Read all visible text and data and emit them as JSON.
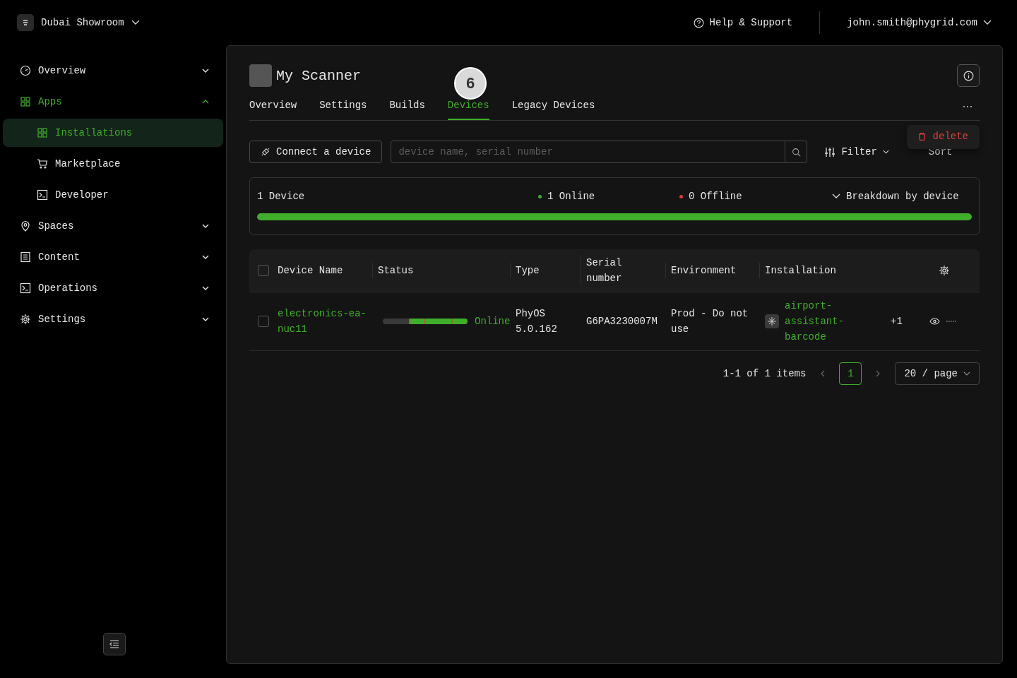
{
  "workspace": {
    "name": "Dubai Showroom"
  },
  "header": {
    "help": "Help & Support",
    "user": "john.smith@phygrid.com"
  },
  "sidebar": {
    "items": [
      {
        "label": "Overview",
        "kind": "gauge",
        "expanded": false,
        "selected": false
      },
      {
        "label": "Apps",
        "kind": "grid",
        "expanded": true,
        "selected": true,
        "children": [
          {
            "label": "Installations",
            "kind": "grid",
            "selected": true
          },
          {
            "label": "Marketplace",
            "kind": "cart",
            "selected": false
          },
          {
            "label": "Developer",
            "kind": "terminal",
            "selected": false
          }
        ]
      },
      {
        "label": "Spaces",
        "kind": "pin",
        "expanded": false,
        "selected": false
      },
      {
        "label": "Content",
        "kind": "list",
        "expanded": false,
        "selected": false
      },
      {
        "label": "Operations",
        "kind": "terminal",
        "expanded": false,
        "selected": false
      },
      {
        "label": "Settings",
        "kind": "gear",
        "expanded": false,
        "selected": false
      }
    ]
  },
  "app": {
    "title": "My Scanner",
    "badge": "6"
  },
  "tabs": [
    {
      "label": "Overview",
      "selected": false
    },
    {
      "label": "Settings",
      "selected": false
    },
    {
      "label": "Builds",
      "selected": false
    },
    {
      "label": "Devices",
      "selected": true
    },
    {
      "label": "Legacy Devices",
      "selected": false
    }
  ],
  "menu": {
    "label": "delete"
  },
  "toolbar": {
    "connect": "Connect a device",
    "search_placeholder": "device name, serial number",
    "filter": "Filter",
    "sort": "Sort"
  },
  "summary": {
    "count": "1 Device",
    "online": "1 Online",
    "offline": "0 Offline",
    "breakdown": "Breakdown by device",
    "level": 1
  },
  "table": {
    "select_all_checked": false,
    "columns": [
      "Device Name",
      "Status",
      "Type",
      "Serial number",
      "Environment",
      "Installation"
    ],
    "rows": [
      {
        "checked": false,
        "name": "electronics-ea-nuc11",
        "status": "Online",
        "online": true,
        "type": "PhyOS 5.0.162",
        "serial": "G6PA3230007M",
        "environment": "Prod - Do not use",
        "installation": "airport-assistant-barcode",
        "extra": "+1"
      }
    ]
  },
  "pagination": {
    "range": "1-1 of 1 items",
    "pages": [
      {
        "label": "1",
        "selected": true
      }
    ],
    "page_size": "20 / page"
  }
}
